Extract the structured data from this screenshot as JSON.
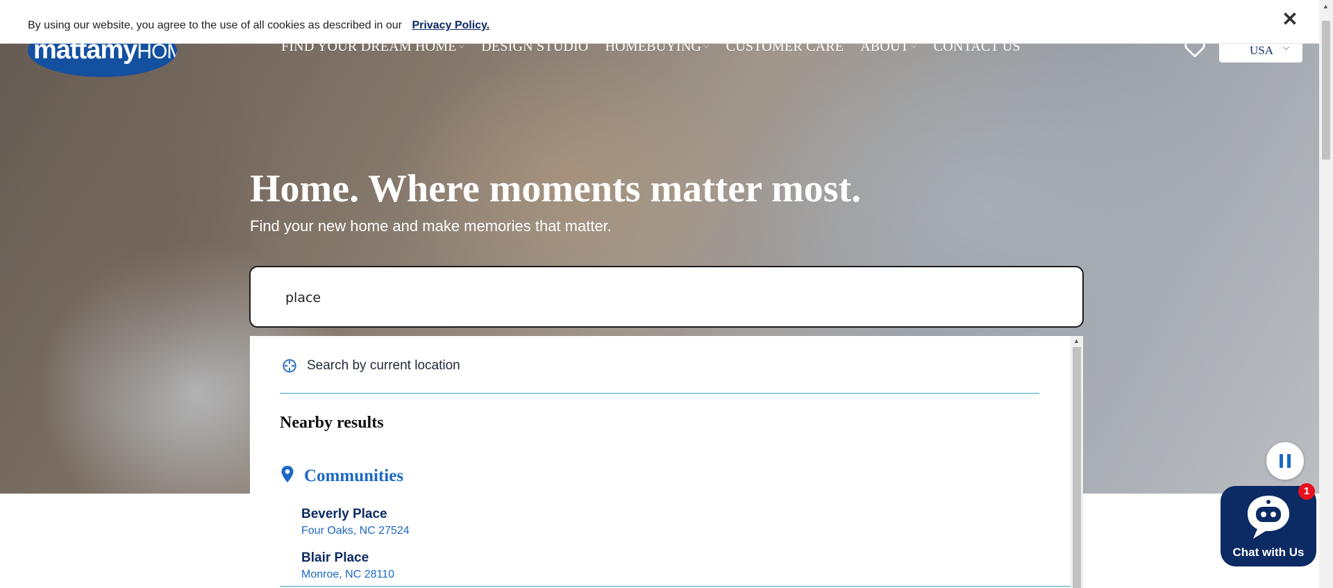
{
  "cookie": {
    "message": "By using our website, you agree to the use of all cookies as described in our",
    "link_label": "Privacy Policy.",
    "close_label": "✕"
  },
  "logo": {
    "brand_bold": "mattamy",
    "brand_light": "HOMES"
  },
  "nav": {
    "items": [
      {
        "label": "FIND YOUR DREAM HOME",
        "has_dropdown": true
      },
      {
        "label": "DESIGN STUDIO",
        "has_dropdown": false
      },
      {
        "label": "HOMEBUYING",
        "has_dropdown": true
      },
      {
        "label": "CUSTOMER CARE",
        "has_dropdown": false
      },
      {
        "label": "ABOUT",
        "has_dropdown": true
      },
      {
        "label": "CONTACT US",
        "has_dropdown": false
      }
    ],
    "chevron": "⌵"
  },
  "country": {
    "selected": "USA",
    "chevron": "⌵"
  },
  "hero": {
    "headline": "Home. Where moments matter most.",
    "subhead": "Find your new home and make memories that matter."
  },
  "search": {
    "value": "place"
  },
  "dropdown": {
    "current_location_label": "Search by current location",
    "nearby_heading": "Nearby results",
    "communities_heading": "Communities",
    "results": [
      {
        "name": "Beverly Place",
        "address": "Four Oaks, NC 27524"
      },
      {
        "name": "Blair Place",
        "address": "Monroe, NC 28110"
      }
    ]
  },
  "chat": {
    "label": "Chat with Us",
    "badge_count": "1"
  },
  "colors": {
    "navy": "#0c2a63",
    "link_blue": "#1b68c4",
    "divider": "#3aa3c8",
    "badge_red": "#e8101c"
  }
}
